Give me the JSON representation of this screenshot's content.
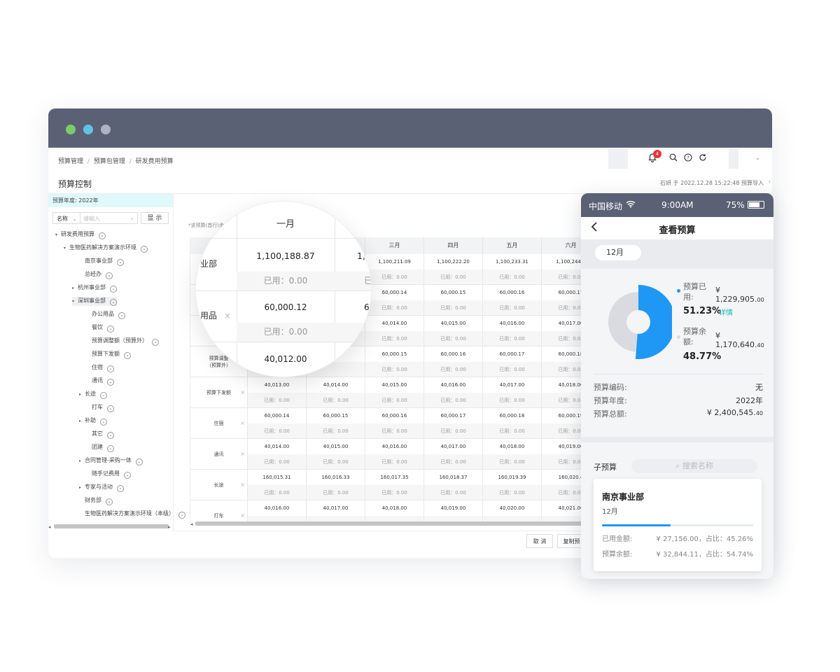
{
  "window": {
    "dots": [
      "#7dca6a",
      "#5cc4e4",
      "#aeb3bf"
    ]
  },
  "header": {
    "breadcrumb": [
      "预算管理",
      "/",
      "预算包管理",
      "/",
      "研发费用预算"
    ],
    "page_title": "预算控制",
    "sync_info": "石妍 于 2022.12.28 15:22:48 预算导入",
    "notification_count": "4",
    "collapse_icon": "chevron-right-icon"
  },
  "tree": {
    "year_label": "预算年度: 2022年",
    "filter_label": "名称",
    "search_placeholder": "请输入",
    "show_button": "显 示",
    "nodes": [
      {
        "label": "研发费用预算",
        "caret": "▾"
      },
      {
        "label": "生物医药解决方案演示环境",
        "caret": "▾"
      },
      {
        "label": "南京事业部",
        "caret": ""
      },
      {
        "label": "总经办",
        "caret": ""
      },
      {
        "label": "杭州事业部",
        "caret": "▸"
      },
      {
        "label": "深圳事业部",
        "caret": "▾"
      },
      {
        "label": "办公用品",
        "caret": ""
      },
      {
        "label": "餐饮",
        "caret": ""
      },
      {
        "label": "预算调整额（预算外）",
        "caret": ""
      },
      {
        "label": "预算下发额",
        "caret": ""
      },
      {
        "label": "住宿",
        "caret": ""
      },
      {
        "label": "通讯",
        "caret": ""
      },
      {
        "label": "长途",
        "caret": "▸"
      },
      {
        "label": "打车",
        "caret": ""
      },
      {
        "label": "补助",
        "caret": "▸"
      },
      {
        "label": "其它",
        "caret": ""
      },
      {
        "label": "团建",
        "caret": ""
      },
      {
        "label": "合同管理-采购一体",
        "caret": "▸"
      },
      {
        "label": "随手记费用",
        "caret": ""
      },
      {
        "label": "专家与活动",
        "caret": "▸"
      },
      {
        "label": "财务部",
        "caret": ""
      },
      {
        "label": "生物医药解决方案演示环境（本级）",
        "caret": ""
      }
    ]
  },
  "grid": {
    "note": "*该预算(首行)余",
    "months": [
      "",
      "",
      "三月",
      "四月",
      "五月",
      "六月"
    ],
    "used_prefix": "已用：",
    "rows": [
      {
        "label": "",
        "values": [
          "",
          "",
          "1,100,211.09",
          "1,100,222.20",
          "1,100,233.31",
          "1,100,244.4"
        ],
        "used": [
          "",
          "",
          "0.00",
          "0.00",
          "0.00",
          "0.00"
        ]
      },
      {
        "label": "",
        "values": [
          "",
          "",
          "60,000.14",
          "60,000.15",
          "60,000.16",
          "60,000.17"
        ],
        "used": [
          "",
          "",
          "0.00",
          "0.00",
          "0.00",
          "0.00"
        ]
      },
      {
        "label": "",
        "values": [
          "",
          "",
          "40,014.00",
          "40,015.00",
          "40,016.00",
          "40,017.00"
        ],
        "used": [
          "",
          "",
          "0.00",
          "0.00",
          "0.00",
          "0.00"
        ]
      },
      {
        "label": "预算调整\n（预算外）",
        "values": [
          "",
          "",
          "60,000.15",
          "60,000.16",
          "60,000.17",
          "60,000.18"
        ],
        "used": [
          "",
          "",
          "0.00",
          "0.00",
          "0.00",
          "0.00"
        ]
      },
      {
        "label": "预算下发额",
        "values": [
          "40,013.00",
          "40,014.00",
          "40,015.00",
          "40,016.00",
          "40,017.00",
          "40,018.00"
        ],
        "used": [
          "0.00",
          "0.00",
          "0.00",
          "0.00",
          "0.00",
          "0.00"
        ]
      },
      {
        "label": "住宿",
        "values": [
          "60,000.14",
          "60,000.15",
          "60,000.16",
          "60,000.17",
          "60,000.18",
          "60,000.19"
        ],
        "used": [
          "0.00",
          "0.00",
          "0.00",
          "0.00",
          "0.00",
          "0.00"
        ]
      },
      {
        "label": "通讯",
        "values": [
          "40,014.00",
          "40,015.00",
          "40,016.00",
          "40,017.00",
          "40,018.00",
          "40,019.00"
        ],
        "used": [
          "0.00",
          "0.00",
          "0.00",
          "0.00",
          "0.00",
          "0.00"
        ]
      },
      {
        "label": "长途",
        "values": [
          "160,015.31",
          "160,016.33",
          "160,017.35",
          "160,018.37",
          "160,019.39",
          "160,020.4"
        ],
        "used": [
          "0.00",
          "0.00",
          "0.00",
          "0.00",
          "0.00",
          "0.00"
        ]
      },
      {
        "label": "打车",
        "values": [
          "40,016.00",
          "40,017.00",
          "40,018.00",
          "40,019.00",
          "40,020.00",
          "40,021.00"
        ],
        "used": [
          "",
          "",
          "",
          "",
          "",
          ""
        ]
      }
    ],
    "cancel_button": "取 消",
    "copy_button": "复制预"
  },
  "magnifier": {
    "col_header": "一月",
    "row1_label": "业部",
    "row1_value": "1,100,188.87",
    "row1_next": "1,",
    "row1_used": "已用：0.00",
    "row1_used_next": "已",
    "row2_label": "用品",
    "row2_value": "60,000.12",
    "row2_next": "6",
    "row2_used": "已用：0.00",
    "row3_value": "40,012.00"
  },
  "phone": {
    "carrier": "中国移动",
    "time": "9:00AM",
    "battery": "75%",
    "title": "查看预算",
    "month": "12月",
    "used_label": "预算已用:",
    "used_amount": "¥ 1,229,905.",
    "used_amount_dec": "00",
    "used_pct": "51.23%",
    "detail_link": "详情",
    "remain_label": "预算余额:",
    "remain_amount": "¥ 1,170,640.",
    "remain_amount_dec": "40",
    "remain_pct": "48.77%",
    "used_fraction": 0.5123,
    "colors": {
      "used": "#1f97f4",
      "remain": "#d9dbe0",
      "link": "#1bb6c4"
    },
    "info": [
      {
        "label": "预算编码:",
        "value": "无"
      },
      {
        "label": "预算年度:",
        "value": "2022年"
      },
      {
        "label": "预算总额:",
        "value": "¥ 2,400,545.",
        "dec": "40"
      }
    ],
    "sub_title": "子预算",
    "sub_search_placeholder": "搜索名称",
    "card": {
      "name": "南京事业部",
      "month": "12月",
      "progress": 0.4526,
      "used_label": "已用金额:",
      "used_value": "¥ 27,156.00，占比：45.26%",
      "remain_label": "预算余额:",
      "remain_value": "¥ 32,844.11，占比：54.74%"
    }
  }
}
